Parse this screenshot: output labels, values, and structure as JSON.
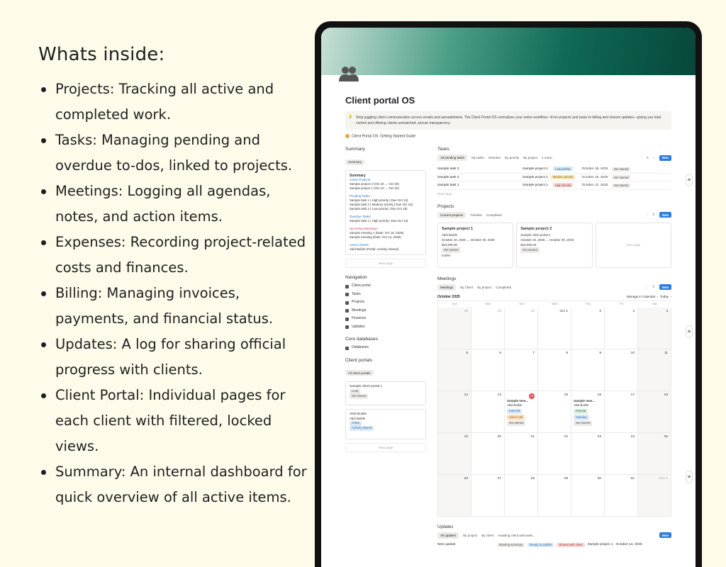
{
  "marketing": {
    "heading": "Whats inside:",
    "items": [
      "Projects: Tracking all active and completed work.",
      "Tasks: Managing pending and overdue to-dos, linked to projects.",
      "Meetings: Logging all agendas, notes, and action items.",
      "Expenses: Recording project-related costs and finances.",
      "Billing: Managing invoices, payments, and financial status.",
      "Updates: A log for sharing official progress with clients.",
      "Client Portal: Individual pages for each client with filtered, locked views.",
      "Summary: An internal dashboard for quick overview of all active items."
    ]
  },
  "page": {
    "title": "Client portal OS",
    "callout": "Stop juggling client communication across emails and spreadsheets. The Client Portal OS centralizes your entire workflow—from projects and tasks to billing and shared updates—giving you total control and offering clients unmatched, secure transparency.",
    "guide_link": "Client Portal OS: Getting Started Guide"
  },
  "sidebar": {
    "summary_heading": "Summary",
    "summary_tab": "Summary",
    "summary_card": {
      "title": "Summary",
      "active_projects_label": "Active Projects:",
      "active_projects": [
        "Sample project 2 (Oct 20 → Oct 30)",
        "Sample project 1 (Oct 10 → Oct 20)"
      ],
      "pending_label": "Pending Tasks:",
      "pending": [
        "Sample task 1 ( High priority | Due Oct 12)",
        "Sample task 2 ( Medium priority | Due Oct 15)",
        "Sample task 3 ( Low priority | Due Oct 18)"
      ],
      "overdue_label": "Overdue Tasks:",
      "overdue": [
        "Sample task 1 ( High priority | Due Oct 12)"
      ],
      "meetings_label": "Upcoming Meetings:",
      "meetings": [
        "Sample meeting 1 (Date: Oct 16, 2025)",
        "Sample meeting (Date: Oct 14, 2025)"
      ],
      "clients_label": "Active Clients:",
      "clients": [
        "Abid Builds (Portal: Actively shared)"
      ]
    },
    "new_page": "New page",
    "navigation_heading": "Navigation",
    "nav": [
      "Client portal",
      "Tasks",
      "Projects",
      "Meetings",
      "Finances",
      "Updates"
    ],
    "core_heading": "Core databases",
    "core": [
      "Databases"
    ],
    "portals_heading": "Client portals",
    "portals_tab": "All client portals",
    "portal_cards": [
      {
        "name": "Sample client portal 1",
        "tag1": "Lead",
        "tag2": "Not shared"
      },
      {
        "name": "Abid Builds",
        "sub": "Abid Builds",
        "tag1": "Active",
        "tag2": "Actively shared"
      }
    ]
  },
  "tasks": {
    "heading": "Tasks",
    "tabs": [
      "All pending tasks",
      "My tasks",
      "Overdue",
      "By priority",
      "By project",
      "1 more..."
    ],
    "new_label": "New",
    "rows": [
      {
        "name": "Sample task 3",
        "project": "Sample project 1",
        "priority": "Low priority",
        "pclass": "low",
        "date": "October 18, 2025",
        "status": "Not started"
      },
      {
        "name": "Sample task 2",
        "project": "Sample project 1",
        "priority": "Medium priority",
        "pclass": "med",
        "date": "October 15, 2025",
        "status": "Not started"
      },
      {
        "name": "Sample task 1",
        "project": "Sample project 1",
        "priority": "High priority",
        "pclass": "high",
        "date": "October 12, 2025",
        "status": "Not started"
      }
    ],
    "new_page": "New page"
  },
  "projects": {
    "heading": "Projects",
    "tabs": [
      "Current projects",
      "Timeline",
      "Completed"
    ],
    "new_label": "New",
    "cards": [
      {
        "title": "Sample project 1",
        "client": "Abid Builds",
        "dates": "October 10, 2025 → October 20, 2025",
        "amount": "$10,000.00",
        "status": "Not started",
        "progress": "0.00%"
      },
      {
        "title": "Sample project 2",
        "client": "Sample client portal 1",
        "dates": "October 20, 2025 → October 30, 2025",
        "amount": "$15,000.00",
        "status": "Not started",
        "progress": ""
      }
    ],
    "new_page": "New page"
  },
  "meetings": {
    "heading": "Meetings",
    "tabs": [
      "Meetings",
      "By Client",
      "By project",
      "Completed"
    ],
    "new_label": "New",
    "month": "October 2025",
    "manage": "Manage in Calendar",
    "today": "Today",
    "dow": [
      "Sun",
      "Mon",
      "Tue",
      "Wed",
      "Thu",
      "Fri",
      "Sat"
    ],
    "days": [
      "28",
      "29",
      "30",
      "Oct 1",
      "2",
      "3",
      "4",
      "5",
      "6",
      "7",
      "8",
      "9",
      "10",
      "11",
      "12",
      "13",
      "14",
      "15",
      "16",
      "17",
      "18",
      "19",
      "20",
      "21",
      "22",
      "23",
      "24",
      "25",
      "26",
      "27",
      "28",
      "29",
      "30",
      "31",
      "Nov 1"
    ],
    "event1": {
      "name": "Sample mee...",
      "client": "Abid Builds",
      "type": "External",
      "kind": "Client Call",
      "status": "Not started"
    },
    "event2": {
      "name": "Sample mee...",
      "client": "Abid Builds",
      "type": "Internal",
      "kind": "Standup",
      "status": "Not started"
    }
  },
  "updates": {
    "heading": "Updates",
    "tabs": [
      "All updates",
      "By project",
      "By client",
      "Awaiting client acknowle..."
    ],
    "new_label": "New",
    "row": {
      "name": "New update",
      "t1": "Meeting summary",
      "t2": "Ready to publish",
      "t3": "Shared with client",
      "project": "Sample project 1",
      "date": "October 14, 2025"
    }
  }
}
